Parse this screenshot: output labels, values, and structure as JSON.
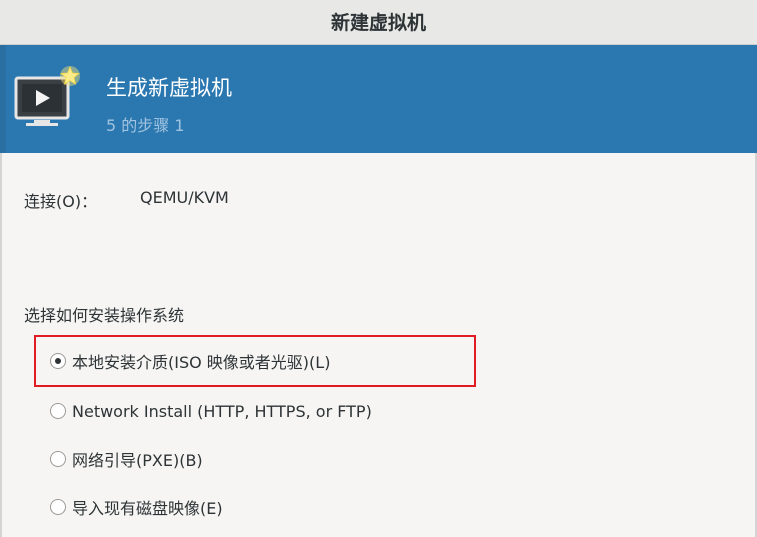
{
  "window": {
    "title": "新建虚拟机"
  },
  "header": {
    "icon": "monitor-play-star-icon",
    "title": "生成新虚拟机",
    "step": "5 的步骤 1",
    "accent_color": "#2b78b0"
  },
  "connection": {
    "label": "连接(O)：",
    "value": "QEMU/KVM"
  },
  "install": {
    "section_label": "选择如何安装操作系统",
    "options": [
      {
        "label": "本地安装介质(ISO 映像或者光驱)(L)",
        "selected": true
      },
      {
        "label": "Network Install (HTTP, HTTPS, or FTP)",
        "selected": false
      },
      {
        "label": "网络引导(PXE)(B)",
        "selected": false
      },
      {
        "label": "导入现有磁盘映像(E)",
        "selected": false
      }
    ]
  },
  "annotation": {
    "highlight_color": "#e01b24"
  }
}
